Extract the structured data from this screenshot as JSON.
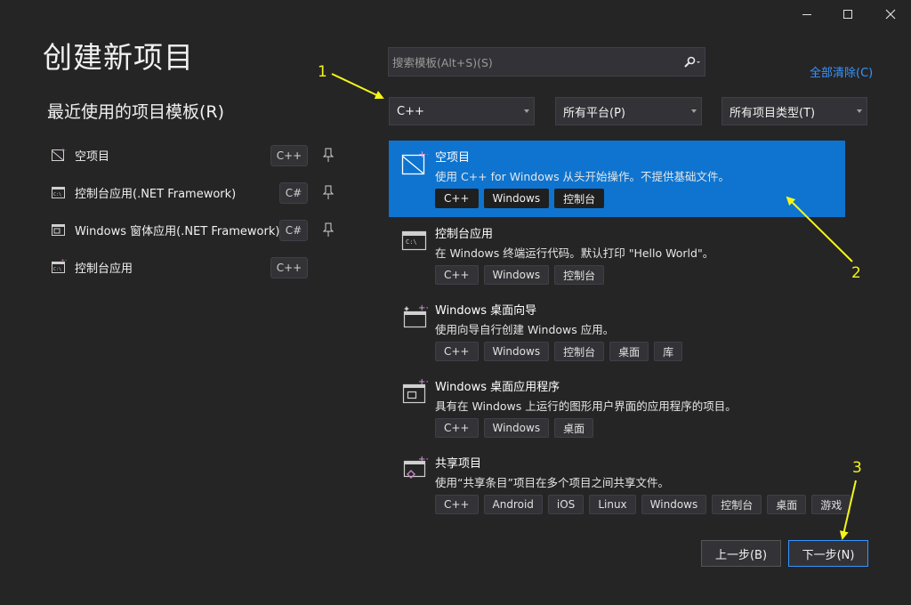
{
  "title": "创建新项目",
  "recent": {
    "heading": "最近使用的项目模板(R)",
    "items": [
      {
        "label": "空项目",
        "lang": "C++",
        "icon": "empty-project-icon"
      },
      {
        "label": "控制台应用(.NET Framework)",
        "lang": "C#",
        "icon": "console-app-icon"
      },
      {
        "label": "Windows 窗体应用(.NET Framework)",
        "lang": "C#",
        "icon": "windows-forms-icon"
      },
      {
        "label": "控制台应用",
        "lang": "C++",
        "icon": "console-app-icon"
      }
    ]
  },
  "search": {
    "placeholder": "搜索模板(Alt+S)(S)",
    "icon": "search-icon"
  },
  "clear_all": "全部清除(C)",
  "filters": {
    "language": "C++",
    "platform": "所有平台(P)",
    "project_type": "所有项目类型(T)"
  },
  "templates": [
    {
      "title": "空项目",
      "desc": "使用 C++ for Windows 从头开始操作。不提供基础文件。",
      "tags": [
        "C++",
        "Windows",
        "控制台"
      ],
      "selected": true,
      "icon": "empty-project-icon"
    },
    {
      "title": "控制台应用",
      "desc": "在 Windows 终端运行代码。默认打印 \"Hello World\"。",
      "tags": [
        "C++",
        "Windows",
        "控制台"
      ],
      "selected": false,
      "icon": "console-app-icon"
    },
    {
      "title": "Windows 桌面向导",
      "desc": "使用向导自行创建 Windows 应用。",
      "tags": [
        "C++",
        "Windows",
        "控制台",
        "桌面",
        "库"
      ],
      "selected": false,
      "icon": "desktop-wizard-icon"
    },
    {
      "title": "Windows 桌面应用程序",
      "desc": "具有在 Windows 上运行的图形用户界面的应用程序的项目。",
      "tags": [
        "C++",
        "Windows",
        "桌面"
      ],
      "selected": false,
      "icon": "desktop-app-icon"
    },
    {
      "title": "共享项目",
      "desc": "使用“共享条目”项目在多个项目之间共享文件。",
      "tags": [
        "C++",
        "Android",
        "iOS",
        "Linux",
        "Windows",
        "控制台",
        "桌面",
        "游戏"
      ],
      "selected": false,
      "icon": "shared-project-icon"
    }
  ],
  "buttons": {
    "back": "上一步(B)",
    "next": "下一步(N)"
  },
  "annotations": [
    "1",
    "2",
    "3"
  ],
  "colors": {
    "background": "#252526",
    "accent": "#0e74cf",
    "link": "#3794ff",
    "annotation": "#f5f51a"
  }
}
